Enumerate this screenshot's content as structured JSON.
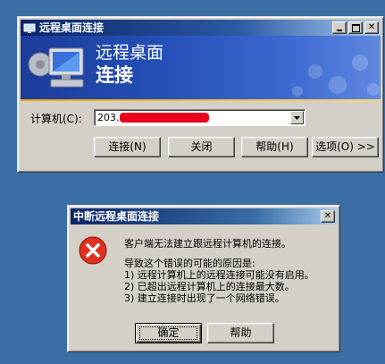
{
  "rd_window": {
    "title": "远程桌面连接",
    "banner_line1": "远程桌面",
    "banner_line2": "连接",
    "computer_label": "计算机(C):",
    "computer_value": "203.",
    "buttons": {
      "connect": "连接(N)",
      "close": "关闭",
      "help": "帮助(H)",
      "options": "选项(O) >>"
    }
  },
  "error_dialog": {
    "title": "中断远程桌面连接",
    "message": "客户端无法建立跟远程计算机的连接。",
    "reasons_intro": "导致这个错误的可能的原因是:",
    "reasons": [
      "1) 远程计算机上的远程连接可能没有启用。",
      "2) 已超出远程计算机上的连接最大数。",
      "3) 建立连接时出现了一个网络错误。"
    ],
    "ok_label": "确定",
    "help_label": "帮助"
  },
  "colors": {
    "desktop": "#3a6ea5",
    "title_active": "#0a246a",
    "error_red": "#e03020",
    "redaction": "#e8001c"
  }
}
